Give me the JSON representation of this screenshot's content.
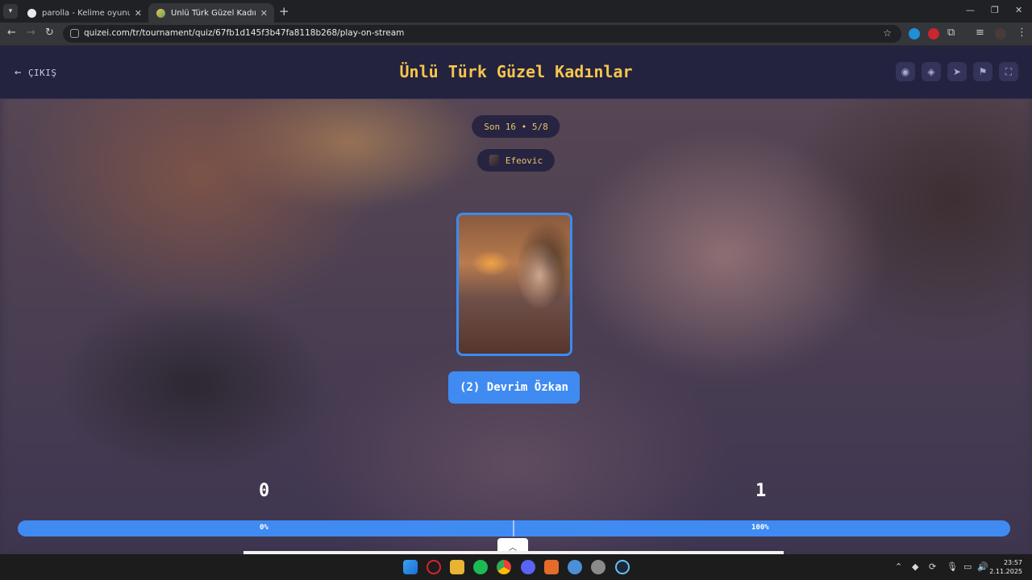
{
  "browser": {
    "tabs": [
      {
        "title": "parolla - Kelime oyunu. Günlük",
        "close": "✕",
        "active": false
      },
      {
        "title": "Ünlü Türk Güzel Kadınlar - Quiz",
        "close": "✕",
        "active": true
      }
    ],
    "new_tab": "+",
    "url": "quizei.com/tr/tournament/quiz/67fb1d145f3b47fa8118b268/play-on-stream",
    "window_controls": {
      "minimize": "—",
      "maximize": "❐",
      "close": "✕"
    },
    "icons": {
      "back": "arrow-left",
      "forward": "arrow-right",
      "reload": "reload",
      "bookmark": "star",
      "extensions": "puzzle",
      "menu": "kebab"
    }
  },
  "header": {
    "exit_label": "ÇIKIŞ",
    "title": "Ünlü Türk Güzel Kadınlar",
    "actions": [
      "eye-icon",
      "shapes-icon",
      "send-icon",
      "flag-icon",
      "fullscreen-icon"
    ]
  },
  "round": {
    "label": "Son 16 • 5/8"
  },
  "streamer": {
    "name": "Efeovic"
  },
  "contestant": {
    "button_label": "(2) Devrim Özkan"
  },
  "scores": {
    "left": "0",
    "right": "1"
  },
  "progress": {
    "left_label": "0%",
    "right_label": "100%",
    "left_fraction": 0.0,
    "right_fraction": 1.0
  },
  "taskbar": {
    "time": "23:57",
    "date": "2.11.2025",
    "apps": [
      "windows-start",
      "opera",
      "file-explorer",
      "spotify",
      "chrome",
      "discord",
      "app",
      "settings",
      "app-notify",
      "steam"
    ]
  },
  "colors": {
    "accent": "#3f8bf2",
    "title": "#f6c54c",
    "header_bg": "#23223f"
  }
}
